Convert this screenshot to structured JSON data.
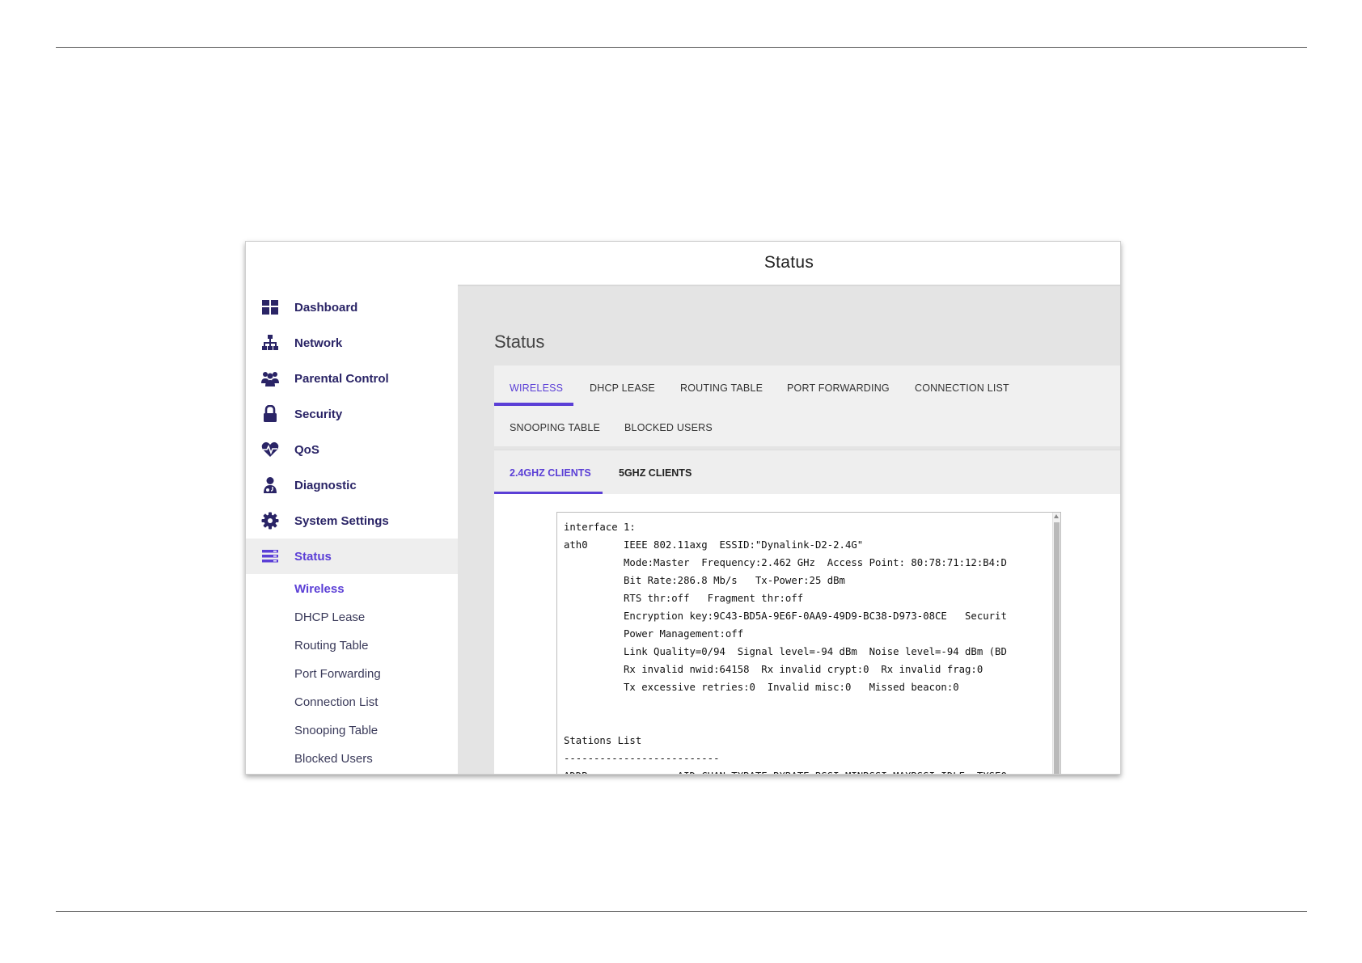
{
  "window": {
    "title": "Status"
  },
  "colors": {
    "accent": "#5b3fd6",
    "nav_text": "#2a2466",
    "content_bg": "#e4e4e4"
  },
  "sidebar": {
    "items": [
      {
        "label": "Dashboard",
        "icon": "dashboard-icon"
      },
      {
        "label": "Network",
        "icon": "network-icon"
      },
      {
        "label": "Parental Control",
        "icon": "parental-control-icon"
      },
      {
        "label": "Security",
        "icon": "lock-icon"
      },
      {
        "label": "QoS",
        "icon": "heartbeat-icon"
      },
      {
        "label": "Diagnostic",
        "icon": "diagnostic-icon"
      },
      {
        "label": "System Settings",
        "icon": "gear-icon"
      },
      {
        "label": "Status",
        "icon": "status-icon"
      }
    ],
    "subitems": [
      "Wireless",
      "DHCP Lease",
      "Routing Table",
      "Port Forwarding",
      "Connection List",
      "Snooping Table",
      "Blocked Users"
    ]
  },
  "main": {
    "heading": "Status",
    "tabs": [
      "WIRELESS",
      "DHCP LEASE",
      "ROUTING TABLE",
      "PORT FORWARDING",
      "CONNECTION LIST",
      "SNOOPING TABLE",
      "BLOCKED USERS"
    ],
    "subtabs": [
      "2.4GHZ CLIENTS",
      "5GHZ CLIENTS"
    ],
    "output_text": "interface 1:\nath0      IEEE 802.11axg  ESSID:\"Dynalink-D2-2.4G\"\n          Mode:Master  Frequency:2.462 GHz  Access Point: 80:78:71:12:B4:D\n          Bit Rate:286.8 Mb/s   Tx-Power:25 dBm\n          RTS thr:off   Fragment thr:off\n          Encryption key:9C43-BD5A-9E6F-0AA9-49D9-BC38-D973-08CE   Securit\n          Power Management:off\n          Link Quality=0/94  Signal level=-94 dBm  Noise level=-94 dBm (BD\n          Rx invalid nwid:64158  Rx invalid crypt:0  Rx invalid frag:0\n          Tx excessive retries:0  Invalid misc:0   Missed beacon:0\n\n\nStations List\n--------------------------\nADDR               AID CHAN TXRATE RXRATE RSSI MINRSSI MAXRSSI IDLE  TXSEQ"
  }
}
